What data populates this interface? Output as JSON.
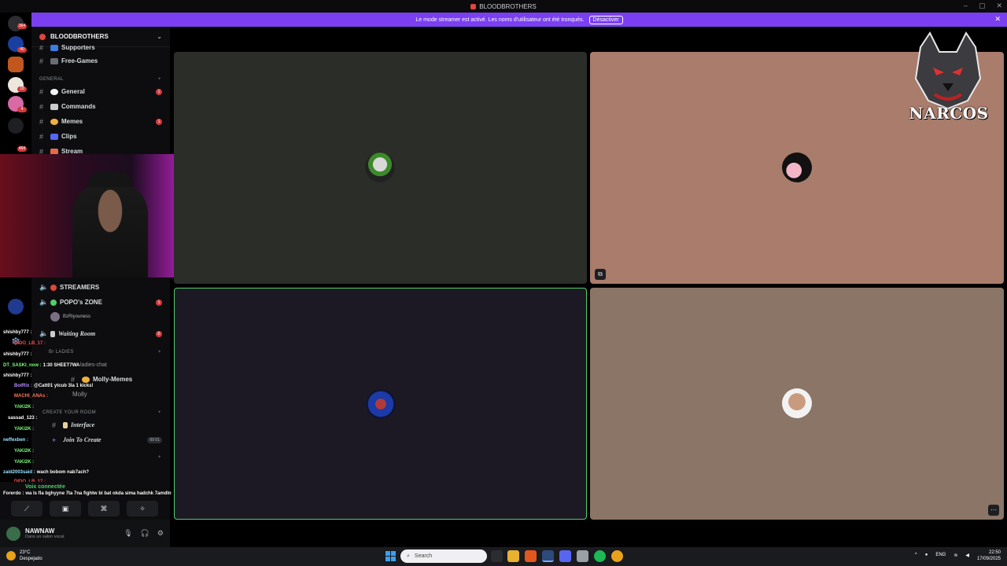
{
  "window": {
    "title": "BLOODBROTHERS",
    "controls": [
      "–",
      "▢",
      "✕"
    ]
  },
  "banner": {
    "text": "Le mode streamer est activé. Les noms d'utilisateur ont été tronqués.",
    "button": "Désactiver"
  },
  "rail": {
    "badges": [
      "364",
      "40",
      "6",
      "18",
      "4",
      "464"
    ]
  },
  "sidebar": {
    "guild": "BLOODBROTHERS",
    "channels_top": [
      {
        "label": "Supporters",
        "count": ""
      },
      {
        "label": "Free-Games",
        "count": ""
      }
    ],
    "category_general": "GENERAL",
    "channels_general": [
      {
        "label": "General",
        "count": "1"
      },
      {
        "label": "Commands",
        "count": ""
      },
      {
        "label": "Memes",
        "count": "1"
      },
      {
        "label": "Clips",
        "count": ""
      },
      {
        "label": "Stream",
        "count": ""
      }
    ],
    "voice_channels": [
      {
        "label": "STREAMERS",
        "count": ""
      },
      {
        "label": "POPO's ZONE",
        "count": "1"
      },
      {
        "label": "BzRiyouness",
        "count": ""
      },
      {
        "label": "Waiting Room",
        "count": "0"
      }
    ],
    "category_ladies": "Br LADIES",
    "ladies_chat": "ladies-chat",
    "molly_memes": "Molly-Memes",
    "molly": "Molly",
    "category_create": "CREATE YOUR ROOM",
    "interface": "Interface",
    "join_to_create": "Join To Create",
    "join_count": "00 01"
  },
  "chat": [
    {
      "name": "shishby777 :",
      "msg": "",
      "color": "#ffffff"
    },
    {
      "name": "DIDO_LB_17 :",
      "msg": "",
      "color": "#ff4d4d"
    },
    {
      "name": "shishby777 :",
      "msg": "",
      "color": "#ffffff"
    },
    {
      "name": "DT_SASKI_now :",
      "msg": "1:30 SHEET7WA",
      "color": "#7cff7c"
    },
    {
      "name": "shishby777 :",
      "msg": "",
      "color": "#ffffff"
    },
    {
      "name": "BotRix :",
      "msg": "@Catt01 ytcub 3la 1 kicks!",
      "color": "#b98cff"
    },
    {
      "name": "MACHI_ANAs :",
      "msg": "",
      "color": "#ff7a5c"
    },
    {
      "name": "YAKI2K :",
      "msg": "",
      "color": "#7cff7c"
    },
    {
      "name": "sassad_123 :",
      "msg": "",
      "color": "#ffffff"
    },
    {
      "name": "YAKI2K :",
      "msg": "",
      "color": "#7cff7c"
    },
    {
      "name": "neffexben :",
      "msg": "",
      "color": "#9be3ff"
    },
    {
      "name": "YAKI2K :",
      "msg": "",
      "color": "#7cff7c"
    },
    {
      "name": "YAKI2K :",
      "msg": "",
      "color": "#7cff7c"
    },
    {
      "name": "zaid2003said :",
      "msg": "wach bobom nab7ach?",
      "color": "#9be3ff"
    },
    {
      "name": "DIDO_LB_17 :",
      "msg": "",
      "color": "#ff4d4d"
    },
    {
      "name": "Forerdo :",
      "msg": "wa ls fla bghyyne 7ta 7na fightw bi bat okda sima hadchk 7amdln",
      "color": "#ffffff"
    }
  ],
  "voice_panel": {
    "status": "Voix connectée"
  },
  "user": {
    "name": "NAWNAW",
    "status": "Dans un salon vocal"
  },
  "logo": {
    "text": "NARCOS"
  },
  "taskbar": {
    "weather_temp": "23°C",
    "weather_desc": "Despejado",
    "search_placeholder": "Search",
    "lang": "ENG",
    "time": "22:50",
    "date": "17/09/2025"
  },
  "colors": {
    "accent": "#7b3ff2",
    "speaking": "#4fcf6b",
    "badge": "#d83a3a"
  }
}
